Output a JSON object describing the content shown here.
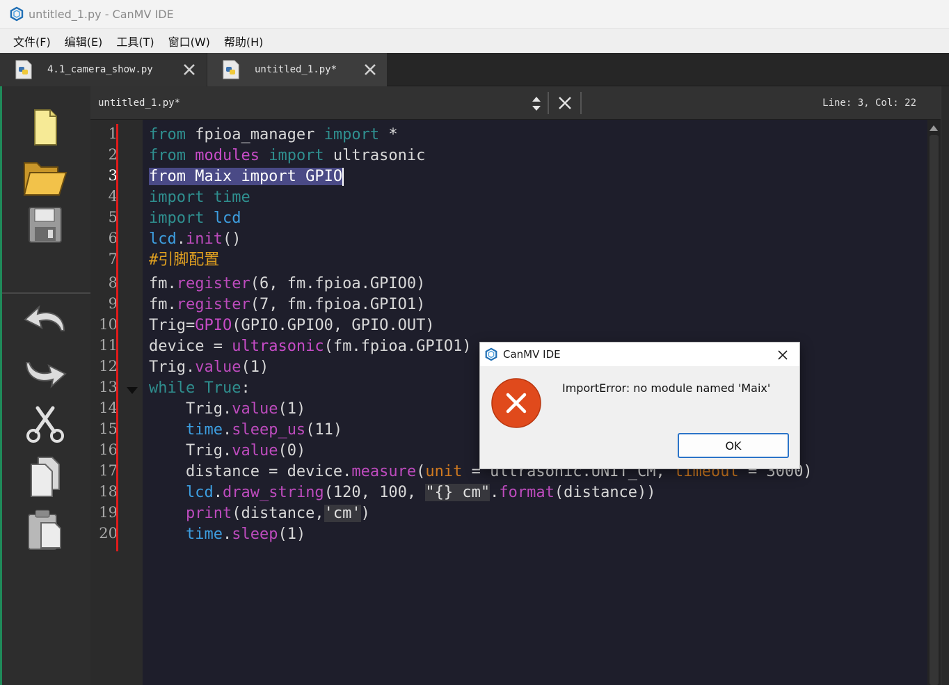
{
  "window": {
    "title": "untitled_1.py - CanMV IDE",
    "app_icon": "canmv-hexagon-icon"
  },
  "menubar": {
    "items": [
      "文件(F)",
      "编辑(E)",
      "工具(T)",
      "窗口(W)",
      "帮助(H)"
    ]
  },
  "tabs": [
    {
      "label": "4.1_camera_show.py",
      "icon": "python-file-icon",
      "active": false
    },
    {
      "label": "untitled_1.py*",
      "icon": "python-file-icon",
      "active": true
    }
  ],
  "toolbar": {
    "icons": [
      "new-file-icon",
      "open-folder-icon",
      "save-icon",
      "undo-icon",
      "redo-icon",
      "cut-icon",
      "copy-icon",
      "paste-icon"
    ]
  },
  "editor": {
    "document_name": "untitled_1.py*",
    "cursor_position": "Line: 3, Col: 22",
    "line_numbers": [
      "1",
      "2",
      "3",
      "4",
      "5",
      "6",
      "7",
      "8",
      "9",
      "10",
      "11",
      "12",
      "13",
      "14",
      "15",
      "16",
      "17",
      "18",
      "19",
      "20"
    ],
    "code": {
      "l1": [
        "from",
        " fpioa_manager ",
        "import",
        " *"
      ],
      "l2": [
        "from",
        " ",
        "modules",
        " ",
        "import",
        " ultrasonic"
      ],
      "l3": [
        "from Maix import GPIO"
      ],
      "l4": [
        "import",
        " ",
        "time"
      ],
      "l5": [
        "import",
        " ",
        "lcd"
      ],
      "l6": [
        "lcd",
        ".",
        "init",
        "()"
      ],
      "l7": [
        "#引脚配置"
      ],
      "l8": [
        "fm.",
        "register",
        "(6, fm.fpioa.GPIO0)"
      ],
      "l9": [
        "fm.",
        "register",
        "(7, fm.fpioa.GPIO1)"
      ],
      "l10": [
        "Trig=",
        "GPIO",
        "(GPIO.GPIO0, GPIO.OUT)"
      ],
      "l11": [
        "device = ",
        "ultrasonic",
        "(fm.fpioa.GPIO1)"
      ],
      "l12": [
        "Trig.",
        "value",
        "(1)"
      ],
      "l13": [
        "while",
        " ",
        "True",
        ":"
      ],
      "l14": [
        "    Trig.",
        "value",
        "(1)"
      ],
      "l15": [
        "    ",
        "time",
        ".",
        "sleep_us",
        "(11)"
      ],
      "l16": [
        "    Trig.",
        "value",
        "(0)"
      ],
      "l17": [
        "    distance = device.",
        "measure",
        "(",
        "unit",
        " = ultrasonic.UNIT_CM, ",
        "timeout",
        " = 3000)"
      ],
      "l18": [
        "    ",
        "lcd",
        ".",
        "draw_string",
        "(120, 100, ",
        "\"{} cm\"",
        ".",
        "format",
        "(distance))"
      ],
      "l19": [
        "    ",
        "print",
        "(distance,",
        "'cm'",
        ")"
      ],
      "l20": [
        "    ",
        "time",
        ".",
        "sleep",
        "(1)"
      ]
    }
  },
  "dialog": {
    "title": "CanMV IDE",
    "message": "ImportError: no module named 'Maix'",
    "ok_label": "OK",
    "icon": "error-icon",
    "error_color": "#e04a1c"
  },
  "colors": {
    "editor_bg": "#1e1e2b",
    "keyword": "#2f8f8f",
    "module": "#c74cc7",
    "builtin": "#3d9ee0",
    "comment": "#e0a020",
    "selection": "#4a4a86",
    "gutter_marker": "#e01b1b"
  }
}
